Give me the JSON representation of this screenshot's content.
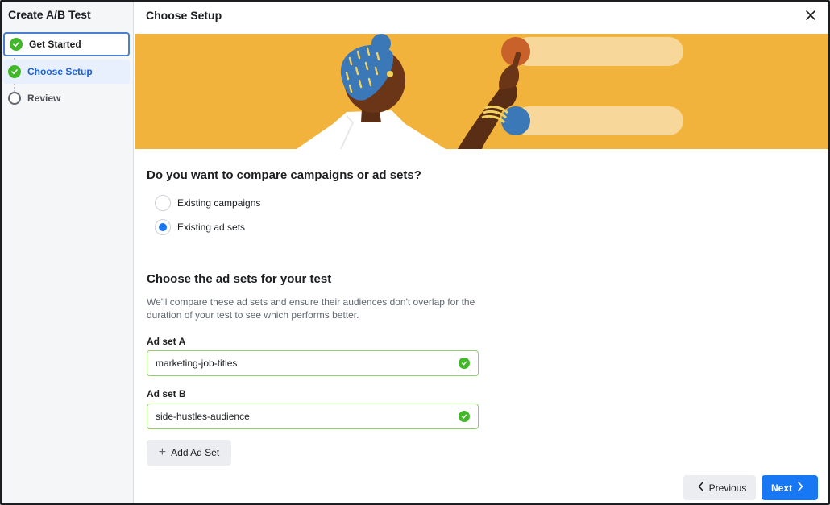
{
  "sidebar": {
    "title": "Create A/B Test",
    "steps": [
      {
        "label": "Get Started",
        "status": "complete"
      },
      {
        "label": "Choose Setup",
        "status": "complete"
      },
      {
        "label": "Review",
        "status": "incomplete"
      }
    ]
  },
  "header": {
    "title": "Choose Setup",
    "close_icon": "close-icon"
  },
  "compare": {
    "question": "Do you want to compare campaigns or ad sets?",
    "options": [
      {
        "label": "Existing campaigns",
        "selected": false
      },
      {
        "label": "Existing ad sets",
        "selected": true
      }
    ]
  },
  "adsets": {
    "title": "Choose the ad sets for your test",
    "description": "We'll compare these ad sets and ensure their audiences don't overlap for the duration of your test to see which performs better.",
    "set_a": {
      "label": "Ad set A",
      "value": "marketing-job-titles"
    },
    "set_b": {
      "label": "Ad set B",
      "value": "side-hustles-audience"
    },
    "add_label": "Add Ad Set"
  },
  "footer": {
    "previous_label": "Previous",
    "next_label": "Next"
  },
  "colors": {
    "accent": "#1877f2",
    "success": "#42b72a",
    "banner": "#f2b33d"
  }
}
